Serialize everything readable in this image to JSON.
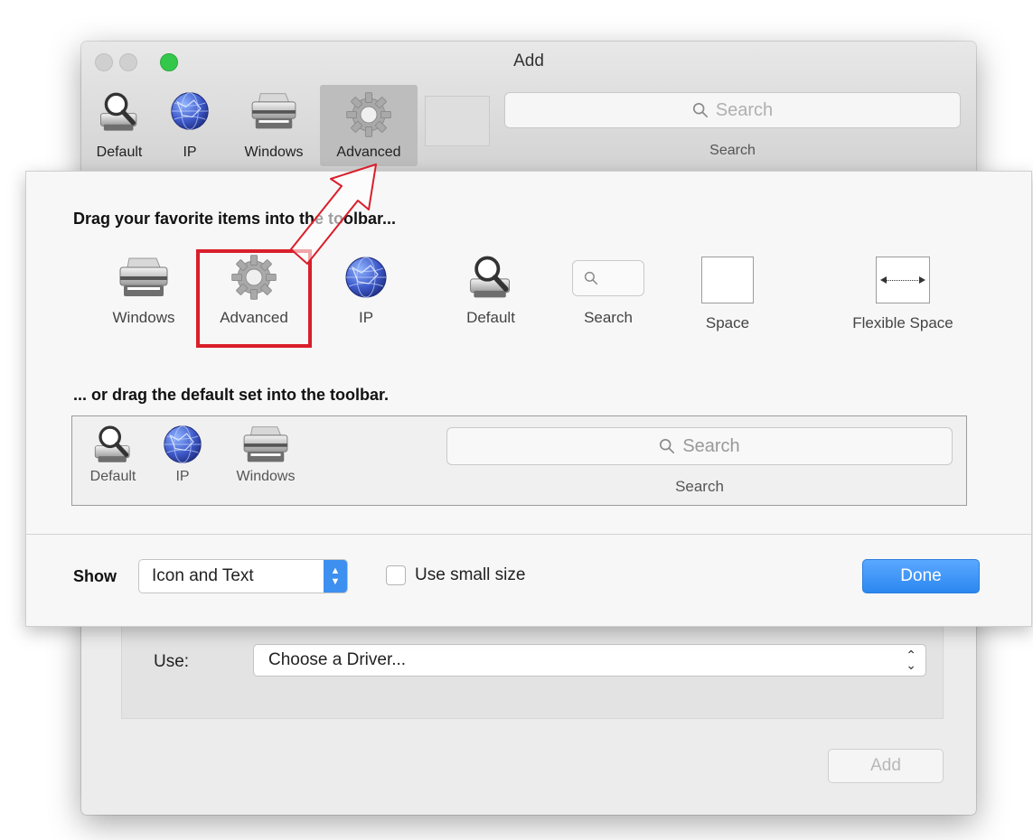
{
  "window": {
    "title": "Add",
    "toolbar": {
      "items": [
        {
          "label": "Default",
          "icon": "default-printer-magnifier-icon"
        },
        {
          "label": "IP",
          "icon": "ip-globe-icon"
        },
        {
          "label": "Windows",
          "icon": "windows-printer-icon"
        },
        {
          "label": "Advanced",
          "icon": "advanced-gear-icon",
          "selected": true
        }
      ],
      "search_placeholder": "Search",
      "search_label": "Search"
    },
    "use_label": "Use:",
    "driver_value": "Choose a Driver...",
    "add_button": "Add"
  },
  "sheet": {
    "heading_palette": "Drag your favorite items into the toolbar...",
    "palette": [
      {
        "label": "Windows",
        "icon": "windows-printer-icon"
      },
      {
        "label": "Advanced",
        "icon": "advanced-gear-icon",
        "highlighted": true
      },
      {
        "label": "IP",
        "icon": "ip-globe-icon"
      },
      {
        "label": "Default",
        "icon": "default-printer-magnifier-icon"
      },
      {
        "label": "Search",
        "icon": "search-field-icon"
      },
      {
        "label": "Space",
        "icon": "space-icon"
      },
      {
        "label": "Flexible Space",
        "icon": "flexible-space-icon"
      }
    ],
    "heading_default": "... or drag the default set into the toolbar.",
    "default_set": {
      "items": [
        {
          "label": "Default"
        },
        {
          "label": "IP"
        },
        {
          "label": "Windows"
        }
      ],
      "search_placeholder": "Search",
      "search_label": "Search"
    },
    "show_label": "Show",
    "show_value": "Icon and Text",
    "small_size_label": "Use small size",
    "small_size_checked": false,
    "done_button": "Done"
  },
  "colors": {
    "highlight": "#d91f2b",
    "done_button": "#2c87f0",
    "traffic_green": "#34c84a"
  }
}
